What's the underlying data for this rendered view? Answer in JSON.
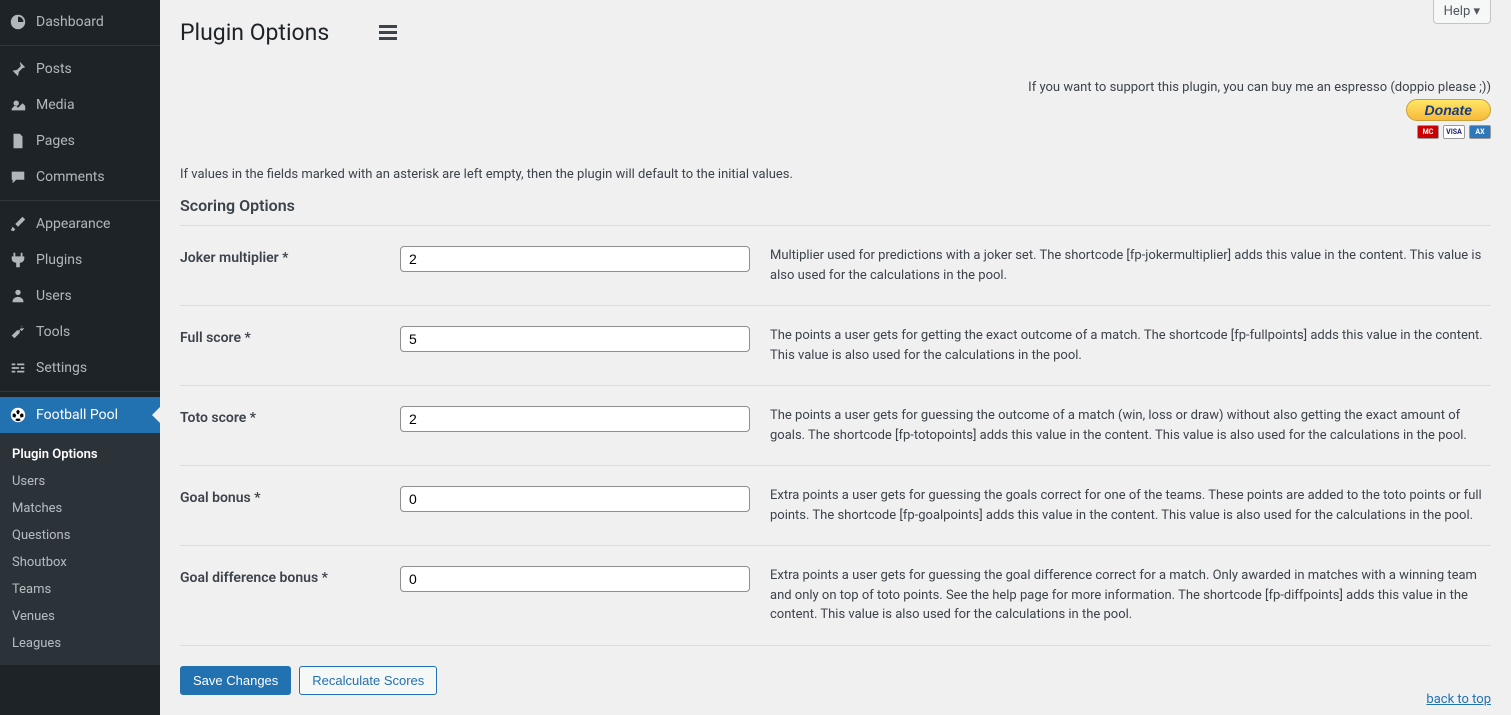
{
  "sidebar": {
    "items": [
      {
        "label": "Dashboard",
        "icon": "dashboard"
      },
      {
        "label": "Posts",
        "icon": "pin"
      },
      {
        "label": "Media",
        "icon": "media"
      },
      {
        "label": "Pages",
        "icon": "page"
      },
      {
        "label": "Comments",
        "icon": "comment"
      },
      {
        "label": "Appearance",
        "icon": "brush"
      },
      {
        "label": "Plugins",
        "icon": "plug"
      },
      {
        "label": "Users",
        "icon": "user"
      },
      {
        "label": "Tools",
        "icon": "wrench"
      },
      {
        "label": "Settings",
        "icon": "sliders"
      },
      {
        "label": "Football Pool",
        "icon": "football"
      }
    ],
    "submenu": [
      "Plugin Options",
      "Users",
      "Matches",
      "Questions",
      "Shoutbox",
      "Teams",
      "Venues",
      "Leagues"
    ]
  },
  "header": {
    "title": "Plugin Options",
    "help_label": "Help ▾"
  },
  "donate": {
    "text": "If you want to support this plugin, you can buy me an espresso (doppio please ;))",
    "button": "Donate"
  },
  "intro": "If values in the fields marked with an asterisk are left empty, then the plugin will default to the initial values.",
  "section_title": "Scoring Options",
  "fields": [
    {
      "label": "Joker multiplier *",
      "value": "2",
      "desc": "Multiplier used for predictions with a joker set. The shortcode [fp-jokermultiplier] adds this value in the content. This value is also used for the calculations in the pool."
    },
    {
      "label": "Full score *",
      "value": "5",
      "desc": "The points a user gets for getting the exact outcome of a match. The shortcode [fp-fullpoints] adds this value in the content. This value is also used for the calculations in the pool."
    },
    {
      "label": "Toto score *",
      "value": "2",
      "desc": "The points a user gets for guessing the outcome of a match (win, loss or draw) without also getting the exact amount of goals. The shortcode [fp-totopoints] adds this value in the content. This value is also used for the calculations in the pool."
    },
    {
      "label": "Goal bonus *",
      "value": "0",
      "desc": "Extra points a user gets for guessing the goals correct for one of the teams. These points are added to the toto points or full points. The shortcode [fp-goalpoints] adds this value in the content. This value is also used for the calculations in the pool."
    },
    {
      "label": "Goal difference bonus *",
      "value": "0",
      "desc": "Extra points a user gets for guessing the goal difference correct for a match. Only awarded in matches with a winning team and only on top of toto points. See the help page for more information. The shortcode [fp-diffpoints] adds this value in the content. This value is also used for the calculations in the pool."
    }
  ],
  "actions": {
    "save": "Save Changes",
    "recalculate": "Recalculate Scores"
  },
  "back_to_top": "back to top"
}
